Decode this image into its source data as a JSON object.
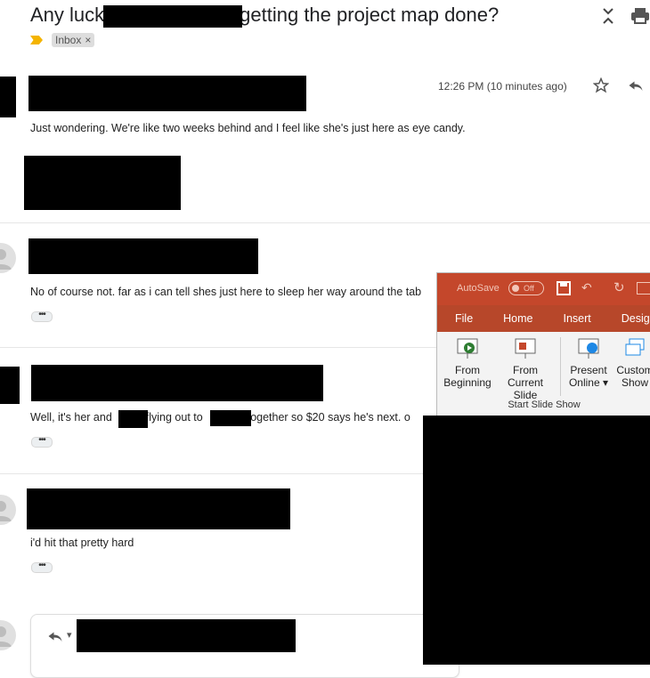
{
  "header": {
    "subject_start": "Any luck",
    "subject_end": "getting the project map done?",
    "expand_icon": "expand-collapse-icon",
    "print_icon": "print-icon",
    "label_chip": "Inbox",
    "label_remove": "×"
  },
  "messages": [
    {
      "timestamp": "12:26 PM (10 minutes ago)",
      "body": "Just wondering. We're like two weeks behind and I feel like she's just here as eye candy."
    },
    {
      "body": "No of course not. far as i can tell shes just here to sleep her way around the tab"
    },
    {
      "body_part1": "Well, it's her and",
      "body_part2": "flying out to",
      "body_part3": "together so $20 says he's next. o"
    },
    {
      "body": "i'd hit that pretty hard"
    }
  ],
  "dots_label": "•••",
  "reply": {
    "reply_icon": "reply-icon",
    "dropdown_glyph": "▾"
  },
  "ppt": {
    "autosave_label": "AutoSave",
    "autosave_state": "Off",
    "tabs": [
      "File",
      "Home",
      "Insert",
      "Design"
    ],
    "buttons": [
      {
        "line1": "From",
        "line2": "Beginning"
      },
      {
        "line1": "From",
        "line2": "Current Slide"
      },
      {
        "line1": "Present",
        "line2": "Online ▾"
      },
      {
        "line1": "Custom",
        "line2": "Show"
      }
    ],
    "group_label": "Start Slide Show",
    "colors": {
      "title_bar": "#c4472b",
      "tab_bar": "#b7472a"
    }
  }
}
